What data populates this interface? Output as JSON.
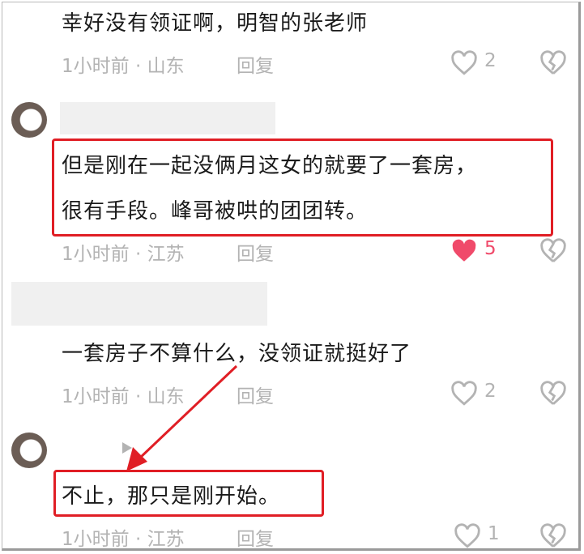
{
  "comments": [
    {
      "text": "幸好没有领证啊，明智的张老师",
      "time": "1小时前 · 山东",
      "reply": "回复",
      "likes": "2",
      "liked": false
    },
    {
      "text_line1": "但是刚在一起没俩月这女的就要了一套房，",
      "text_line2": "很有手段。峰哥被哄的团团转。",
      "time": "1小时前 · 江苏",
      "reply": "回复",
      "likes": "5",
      "liked": true
    },
    {
      "text": "一套房子不算什么，没领证就挺好了",
      "time": "1小时前 · 山东",
      "reply": "回复",
      "likes": "2",
      "liked": false
    },
    {
      "text": "不止，那只是刚开始。",
      "time": "1小时前 · 江苏",
      "reply": "回复",
      "likes": "1",
      "liked": false
    }
  ],
  "icons": {
    "like": "heart-outline-icon",
    "liked": "heart-filled-icon",
    "dislike": "broken-heart-icon",
    "play": "play-triangle-icon"
  },
  "colors": {
    "highlight": "#e01e25",
    "liked": "#f04a6a",
    "meta": "#b3b3b3"
  }
}
